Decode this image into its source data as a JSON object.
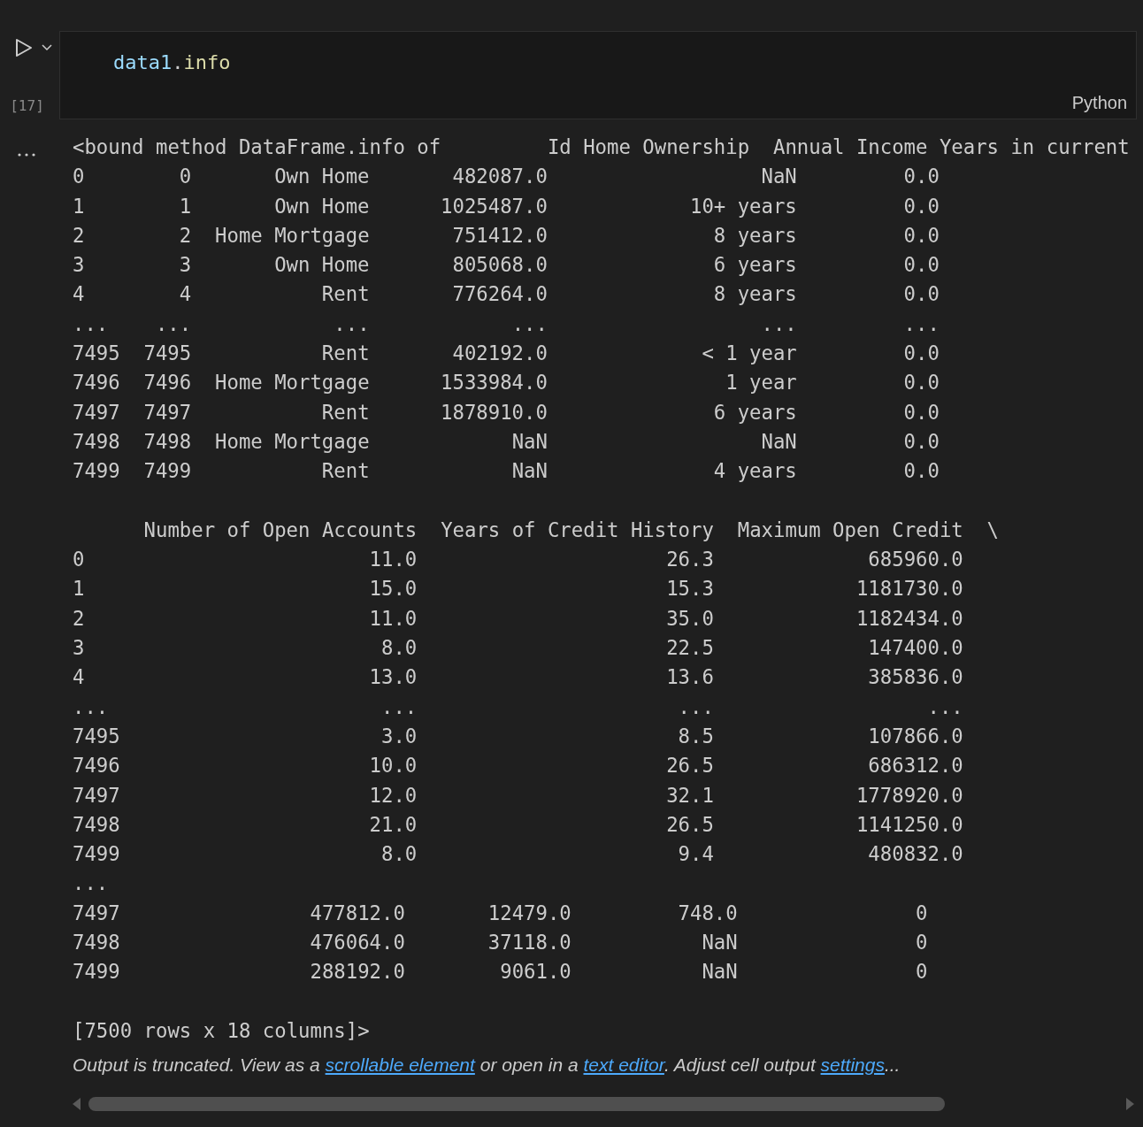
{
  "cell": {
    "execution_count": "[17]",
    "code": [
      {
        "kind": "variable",
        "text": "data1"
      },
      {
        "kind": "punctuation",
        "text": "."
      },
      {
        "kind": "function",
        "text": "info"
      }
    ],
    "language": "Python"
  },
  "output": {
    "items": [
      {
        "kind": "table",
        "preamble": "<bound method DataFrame.info of",
        "header": [
          {
            "text": "Id",
            "cut": false
          },
          {
            "text": "Home Ownership",
            "cut": false
          },
          {
            "text": "Annual Income",
            "cut": false
          },
          {
            "text": "Years in current",
            "cut": true
          }
        ],
        "rows": [
          {
            "index": "0",
            "cells": [
              "0",
              "Own Home",
              "482087.0",
              "NaN",
              "0.0"
            ]
          },
          {
            "index": "1",
            "cells": [
              "1",
              "Own Home",
              "1025487.0",
              "10+ years",
              "0.0"
            ]
          },
          {
            "index": "2",
            "cells": [
              "2",
              "Home Mortgage",
              "751412.0",
              "8 years",
              "0.0"
            ]
          },
          {
            "index": "3",
            "cells": [
              "3",
              "Own Home",
              "805068.0",
              "6 years",
              "0.0"
            ]
          },
          {
            "index": "4",
            "cells": [
              "4",
              "Rent",
              "776264.0",
              "8 years",
              "0.0"
            ]
          },
          {
            "index": "...",
            "cells": [
              "...",
              "...",
              "...",
              "...",
              "..."
            ]
          },
          {
            "index": "7495",
            "cells": [
              "7495",
              "Rent",
              "402192.0",
              "< 1 year",
              "0.0"
            ]
          },
          {
            "index": "7496",
            "cells": [
              "7496",
              "Home Mortgage",
              "1533984.0",
              "1 year",
              "0.0"
            ]
          },
          {
            "index": "7497",
            "cells": [
              "7497",
              "Rent",
              "1878910.0",
              "6 years",
              "0.0"
            ]
          },
          {
            "index": "7498",
            "cells": [
              "7498",
              "Home Mortgage",
              "NaN",
              "NaN",
              "0.0"
            ]
          },
          {
            "index": "7499",
            "cells": [
              "7499",
              "Rent",
              "NaN",
              "4 years",
              "0.0"
            ]
          }
        ]
      },
      {
        "kind": "gap"
      },
      {
        "kind": "table",
        "header": [
          {
            "text": "Number of Open Accounts",
            "cut": false
          },
          {
            "text": "Years of Credit History",
            "cut": false
          },
          {
            "text": "Maximum Open Credit",
            "cut": false
          },
          {
            "text": "\\",
            "cut": false
          }
        ],
        "rows": [
          {
            "index": "0",
            "cells": [
              "11.0",
              "26.3",
              "685960.0"
            ]
          },
          {
            "index": "1",
            "cells": [
              "15.0",
              "15.3",
              "1181730.0"
            ]
          },
          {
            "index": "2",
            "cells": [
              "11.0",
              "35.0",
              "1182434.0"
            ]
          },
          {
            "index": "3",
            "cells": [
              "8.0",
              "22.5",
              "147400.0"
            ]
          },
          {
            "index": "4",
            "cells": [
              "13.0",
              "13.6",
              "385836.0"
            ]
          },
          {
            "index": "...",
            "cells": [
              "...",
              "...",
              "..."
            ]
          },
          {
            "index": "7495",
            "cells": [
              "3.0",
              "8.5",
              "107866.0"
            ]
          },
          {
            "index": "7496",
            "cells": [
              "10.0",
              "26.5",
              "686312.0"
            ]
          },
          {
            "index": "7497",
            "cells": [
              "12.0",
              "32.1",
              "1778920.0"
            ]
          },
          {
            "index": "7498",
            "cells": [
              "21.0",
              "26.5",
              "1141250.0"
            ]
          },
          {
            "index": "7499",
            "cells": [
              "8.0",
              "9.4",
              "480832.0"
            ]
          }
        ]
      },
      {
        "kind": "text",
        "text": "..."
      },
      {
        "kind": "table",
        "rows": [
          {
            "index": "7497",
            "cells": [
              "477812.0",
              "12479.0",
              "748.0",
              "0"
            ]
          },
          {
            "index": "7498",
            "cells": [
              "476064.0",
              "37118.0",
              "NaN",
              "0"
            ]
          },
          {
            "index": "7499",
            "cells": [
              "288192.0",
              "9061.0",
              "NaN",
              "0"
            ]
          }
        ]
      },
      {
        "kind": "gap"
      },
      {
        "kind": "text",
        "text": "[7500 rows x 18 columns]>"
      }
    ],
    "notice": [
      {
        "kind": "plain",
        "text": "Output is truncated. View as a "
      },
      {
        "kind": "link",
        "text": "scrollable element"
      },
      {
        "kind": "plain",
        "text": " or open in a "
      },
      {
        "kind": "link",
        "text": "text editor"
      },
      {
        "kind": "plain",
        "text": ". Adjust cell output "
      },
      {
        "kind": "link",
        "text": "settings"
      },
      {
        "kind": "plain",
        "text": "..."
      }
    ]
  }
}
